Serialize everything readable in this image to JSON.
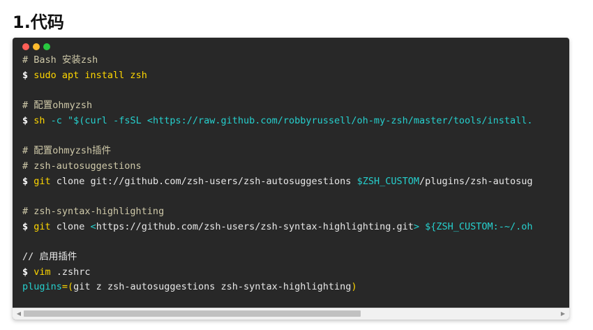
{
  "section": {
    "heading": "1.代码"
  },
  "window_controls": {
    "colors": [
      "#ff5f57",
      "#febc2e",
      "#28c840"
    ],
    "names": [
      "close-dot",
      "minimize-dot",
      "maximize-dot"
    ]
  },
  "code_lines": [
    [
      {
        "t": "# Bash 安装zsh",
        "c": "comment"
      }
    ],
    [
      {
        "t": "$ ",
        "c": "prompt"
      },
      {
        "t": "sudo apt install zsh",
        "c": "yellow"
      }
    ],
    [],
    [
      {
        "t": "# 配置ohmyzsh",
        "c": "comment"
      }
    ],
    [
      {
        "t": "$ ",
        "c": "prompt"
      },
      {
        "t": "sh",
        "c": "yellow"
      },
      {
        "t": " -c \"$(curl -fsSL <https://raw.github.com/robbyrussell/oh-my-zsh/master/tools/install.",
        "c": "cyan"
      }
    ],
    [],
    [
      {
        "t": "# 配置ohmyzsh插件",
        "c": "comment"
      }
    ],
    [
      {
        "t": "# zsh-autosuggestions",
        "c": "comment"
      }
    ],
    [
      {
        "t": "$ ",
        "c": "prompt"
      },
      {
        "t": "git",
        "c": "yellow"
      },
      {
        "t": " clone git://github.com/zsh-users/zsh-autosuggestions ",
        "c": "plain"
      },
      {
        "t": "$ZSH_CUSTOM",
        "c": "cyan"
      },
      {
        "t": "/plugins/zsh-autosug",
        "c": "plain"
      }
    ],
    [],
    [
      {
        "t": "# zsh-syntax-highlighting",
        "c": "comment"
      }
    ],
    [
      {
        "t": "$ ",
        "c": "prompt"
      },
      {
        "t": "git",
        "c": "yellow"
      },
      {
        "t": " clone ",
        "c": "plain"
      },
      {
        "t": "<",
        "c": "cyan"
      },
      {
        "t": "https://github.com/zsh-users/zsh-syntax-highlighting.git",
        "c": "plain"
      },
      {
        "t": "> ${ZSH_CUSTOM:-~/.oh",
        "c": "cyan"
      }
    ],
    [],
    [
      {
        "t": "// 启用插件",
        "c": "plain"
      }
    ],
    [
      {
        "t": "$ ",
        "c": "prompt"
      },
      {
        "t": "vim",
        "c": "yellow"
      },
      {
        "t": " .zshrc",
        "c": "plain"
      }
    ],
    [
      {
        "t": "plugins",
        "c": "cyan"
      },
      {
        "t": "=(",
        "c": "yellow"
      },
      {
        "t": "git z zsh-autosuggestions zsh-syntax-highlighting",
        "c": "plain"
      },
      {
        "t": ")",
        "c": "yellow"
      }
    ]
  ],
  "scrollbar": {
    "left_arrow": "◀",
    "right_arrow": "▶",
    "thumb_fraction": 0.63,
    "position_fraction": 0.0
  }
}
